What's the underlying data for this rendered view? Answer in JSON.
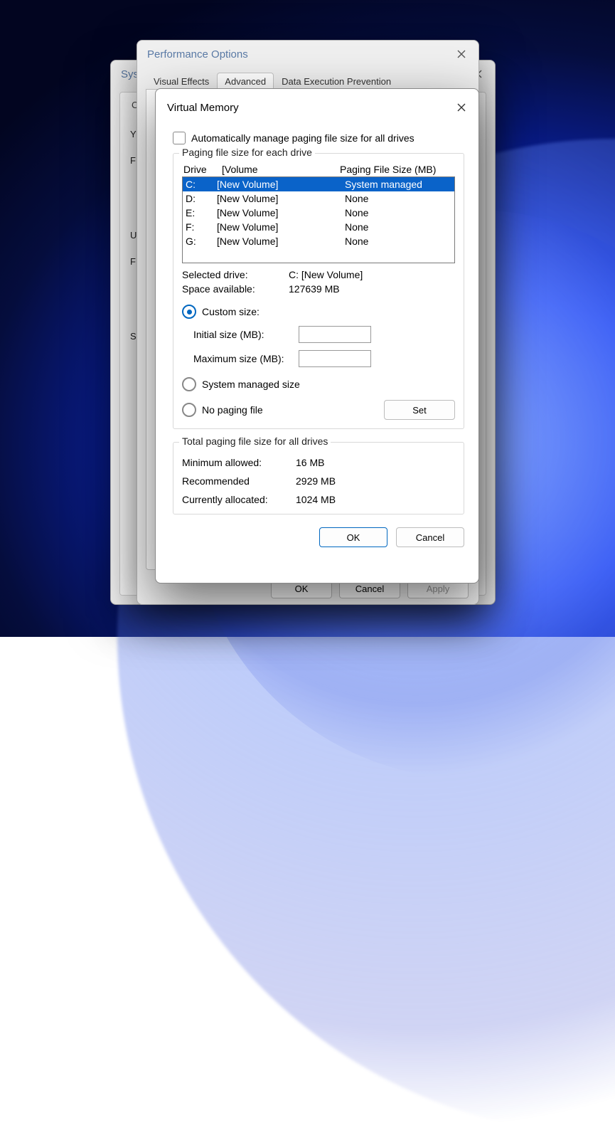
{
  "sys": {
    "title": "Syste",
    "tab": "Com",
    "rows": [
      "Y",
      "F",
      "U",
      "F",
      "S"
    ]
  },
  "perf": {
    "title": "Performance Options",
    "tabs": {
      "visual": "Visual Effects",
      "advanced": "Advanced",
      "dep": "Data Execution Prevention"
    },
    "buttons": {
      "ok": "OK",
      "cancel": "Cancel",
      "apply": "Apply"
    }
  },
  "vm": {
    "title": "Virtual Memory",
    "auto_manage": "Automatically manage paging file size for all drives",
    "group_drives_legend": "Paging file size for each drive",
    "hdr_drive": "Drive",
    "hdr_volume": "[Volume",
    "hdr_size": "Paging File Size (MB)",
    "drives": [
      {
        "letter": "C:",
        "volume": "[New Volume]",
        "size": "System managed",
        "selected": true
      },
      {
        "letter": "D:",
        "volume": "[New Volume]",
        "size": "None",
        "selected": false
      },
      {
        "letter": "E:",
        "volume": "[New Volume]",
        "size": "None",
        "selected": false
      },
      {
        "letter": "F:",
        "volume": "[New Volume]",
        "size": "None",
        "selected": false
      },
      {
        "letter": "G:",
        "volume": "[New Volume]",
        "size": "None",
        "selected": false
      }
    ],
    "selected_drive_label": "Selected drive:",
    "selected_drive_value": "C:  [New Volume]",
    "space_label": "Space available:",
    "space_value": "127639 MB",
    "opt_custom": "Custom size:",
    "initial_label": "Initial size (MB):",
    "initial_value": "",
    "max_label": "Maximum size (MB):",
    "max_value": "",
    "opt_system": "System managed size",
    "opt_none": "No paging file",
    "set_button": "Set",
    "group_totals_legend": "Total paging file size for all drives",
    "min_label": "Minimum allowed:",
    "min_value": "16 MB",
    "rec_label": "Recommended",
    "rec_value": "2929 MB",
    "cur_label": "Currently allocated:",
    "cur_value": "1024 MB",
    "ok": "OK",
    "cancel": "Cancel"
  }
}
